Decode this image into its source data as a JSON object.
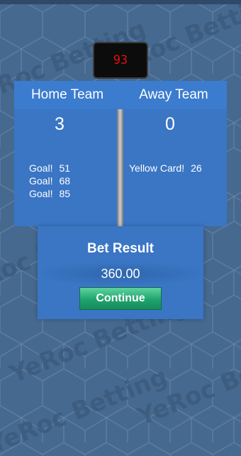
{
  "colors": {
    "background": "#46698f",
    "panel": "#3a76c4",
    "timer_digits": "#e01010",
    "continue_button": "#1fa36e"
  },
  "watermark": {
    "text": "YeRoc Betting"
  },
  "match": {
    "minute": "93",
    "home": {
      "name": "Home Team",
      "score": "3",
      "events": [
        {
          "type": "Goal!",
          "minute": "51"
        },
        {
          "type": "Goal!",
          "minute": "68"
        },
        {
          "type": "Goal!",
          "minute": "85"
        }
      ]
    },
    "away": {
      "name": "Away Team",
      "score": "0",
      "events": [
        {
          "type": "Yellow Card!",
          "minute": "26"
        }
      ]
    }
  },
  "bet_result": {
    "title": "Bet Result",
    "amount": "360.00",
    "continue_label": "Continue"
  }
}
